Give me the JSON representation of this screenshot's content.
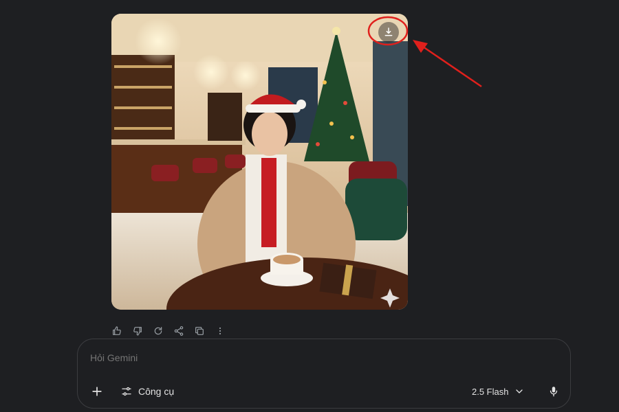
{
  "colors": {
    "background": "#1e1f22",
    "annotation_red": "#e0201c",
    "icon_gray": "#9aa0a6",
    "text": "#e3e3e3"
  },
  "image": {
    "alt": "Christmas café portrait",
    "download_icon": "download-icon"
  },
  "actions": {
    "icons": [
      "thumb-up-icon",
      "thumb-down-icon",
      "redo-icon",
      "share-icon",
      "copy-icon",
      "more-vert-icon"
    ]
  },
  "composer": {
    "placeholder": "Hỏi Gemini",
    "tools_label": "Công cụ",
    "model_label": "2.5 Flash"
  }
}
